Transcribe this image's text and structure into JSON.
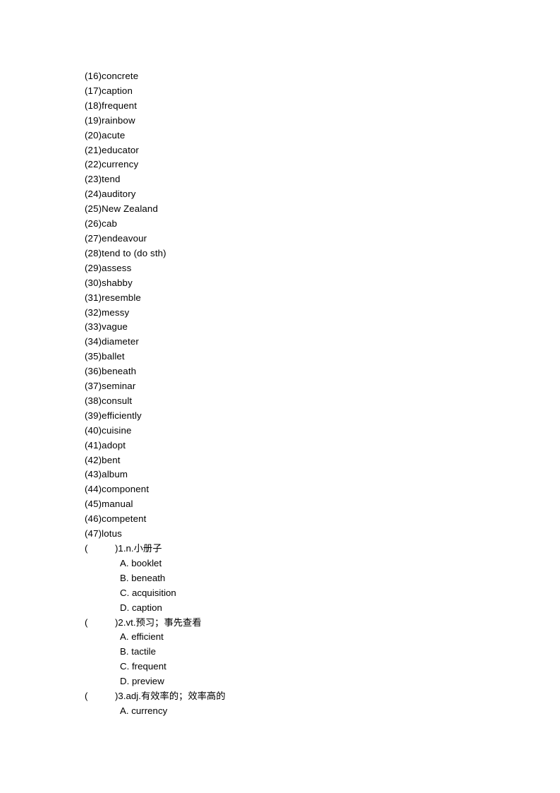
{
  "document": {
    "background_color": "#ffffff",
    "text_color": "#000000",
    "paren_open": "(",
    "paren_close": ")"
  },
  "word_list": [
    {
      "label": "(16)concrete"
    },
    {
      "label": "(17)caption"
    },
    {
      "label": "(18)frequent"
    },
    {
      "label": "(19)rainbow"
    },
    {
      "label": "(20)acute"
    },
    {
      "label": "(21)educator"
    },
    {
      "label": "(22)currency"
    },
    {
      "label": "(23)tend"
    },
    {
      "label": "(24)auditory"
    },
    {
      "label": "(25)New Zealand"
    },
    {
      "label": "(26)cab"
    },
    {
      "label": "(27)endeavour"
    },
    {
      "label": "(28)tend to (do sth)"
    },
    {
      "label": "(29)assess"
    },
    {
      "label": "(30)shabby"
    },
    {
      "label": "(31)resemble"
    },
    {
      "label": "(32)messy"
    },
    {
      "label": "(33)vague"
    },
    {
      "label": "(34)diameter"
    },
    {
      "label": "(35)ballet"
    },
    {
      "label": "(36)beneath"
    },
    {
      "label": "(37)seminar"
    },
    {
      "label": "(38)consult"
    },
    {
      "label": "(39)efficiently"
    },
    {
      "label": "(40)cuisine"
    },
    {
      "label": "(41)adopt"
    },
    {
      "label": "(42)bent"
    },
    {
      "label": "(43)album"
    },
    {
      "label": "(44)component"
    },
    {
      "label": "(45)manual"
    },
    {
      "label": "(46)competent"
    },
    {
      "label": "(47)lotus"
    }
  ],
  "questions": [
    {
      "stem": ")1.n.小册子",
      "options": [
        {
          "label": "A. booklet"
        },
        {
          "label": "B. beneath"
        },
        {
          "label": "C. acquisition"
        },
        {
          "label": "D. caption"
        }
      ]
    },
    {
      "stem": ")2.vt.预习；事先查看",
      "options": [
        {
          "label": "A. efficient"
        },
        {
          "label": "B. tactile"
        },
        {
          "label": "C. frequent"
        },
        {
          "label": "D. preview"
        }
      ]
    },
    {
      "stem": ")3.adj.有效率的；效率高的",
      "options": [
        {
          "label": "A. currency"
        }
      ]
    }
  ]
}
